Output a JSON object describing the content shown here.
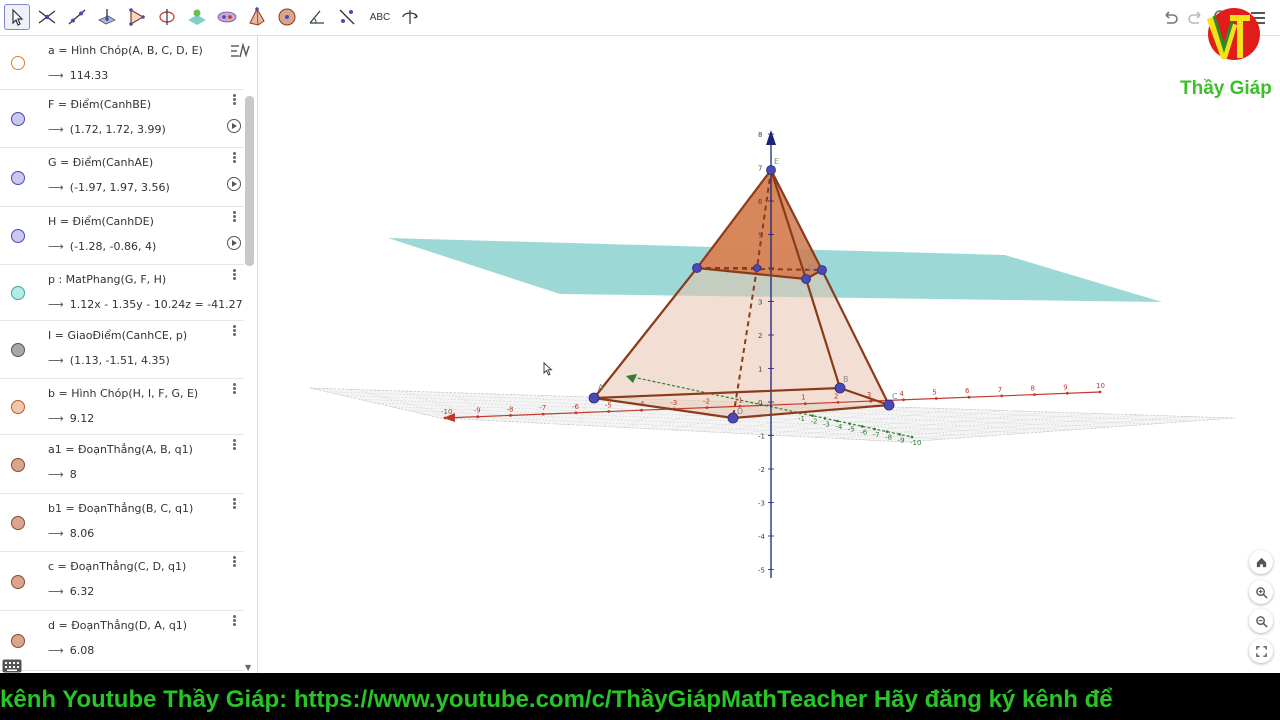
{
  "toolbar": {
    "tools": [
      {
        "name": "move-tool-icon",
        "active": true
      },
      {
        "name": "intersect-tool-icon"
      },
      {
        "name": "line-tool-icon"
      },
      {
        "name": "perpendicular-plane-tool-icon"
      },
      {
        "name": "polygon-tool-icon"
      },
      {
        "name": "circle-axis-tool-icon"
      },
      {
        "name": "plane-tool-icon"
      },
      {
        "name": "net-tool-icon"
      },
      {
        "name": "pyramid-tool-icon"
      },
      {
        "name": "sphere-tool-icon"
      },
      {
        "name": "angle-tool-icon"
      },
      {
        "name": "reflect-tool-icon"
      },
      {
        "name": "text-tool-icon",
        "text": "ABC"
      },
      {
        "name": "rotate-view-tool-icon"
      }
    ]
  },
  "algebra": {
    "rows": [
      {
        "def": "a = Hình Chóp(A, B, C, D, E)",
        "value": "114.33",
        "color": "#ffffff",
        "border": "#d9812f",
        "play": false
      },
      {
        "def": "F = Điểm(CanhBE)",
        "value": "(1.72, 1.72, 3.99)",
        "color": "#c8c8f0",
        "border": "#4a4ab0",
        "play": true
      },
      {
        "def": "G = Điểm(CanhAE)",
        "value": "(-1.97, 1.97, 3.56)",
        "color": "#c8c8f0",
        "border": "#4a4ab0",
        "play": true
      },
      {
        "def": "H = Điểm(CanhDE)",
        "value": "(-1.28, -0.86, 4)",
        "color": "#c8c8f0",
        "border": "#4a4ab0",
        "play": true
      },
      {
        "def": "p : MatPhang(G, F, H)",
        "value": "1.12x - 1.35y - 10.24z = -41.27",
        "color": "#b6ece8",
        "border": "#3aa59c",
        "play": false
      },
      {
        "def": "I = GiaoĐiểm(CanhCE, p)",
        "value": "(1.13, -1.51, 4.35)",
        "color": "#a8a8a8",
        "border": "#555555",
        "play": false
      },
      {
        "def": "b = Hình Chóp(H, I, F, G, E)",
        "value": "9.12",
        "color": "#f2c6a8",
        "border": "#b06030",
        "play": false
      },
      {
        "def": "a1 = ĐoạnThẳng(A, B, q1)",
        "value": "8",
        "color": "#d9a58c",
        "border": "#8a4a30",
        "play": false
      },
      {
        "def": "b1 = ĐoạnThẳng(B, C, q1)",
        "value": "8.06",
        "color": "#d9a58c",
        "border": "#8a4a30",
        "play": false
      },
      {
        "def": "c = ĐoạnThẳng(C, D, q1)",
        "value": "6.32",
        "color": "#d9a58c",
        "border": "#8a4a30",
        "play": false
      },
      {
        "def": "d = ĐoạnThẳng(D, A, q1)",
        "value": "6.08",
        "color": "#d9a58c",
        "border": "#8a4a30",
        "play": false
      }
    ]
  },
  "graphics": {
    "z_ticks": [
      "8",
      "7",
      "6",
      "5",
      "4",
      "3",
      "2",
      "1",
      "0",
      "-1",
      "-2",
      "-3",
      "-4",
      "-5"
    ],
    "x_ticks": [
      "-10",
      "-9",
      "-8",
      "-7",
      "-6",
      "-5",
      "-4",
      "-3",
      "-2",
      "-1",
      "1",
      "2",
      "3",
      "4",
      "5",
      "6",
      "7",
      "8",
      "9",
      "10"
    ],
    "y_ticks": [
      "-10",
      "-9",
      "-8",
      "-7",
      "-6",
      "-5",
      "-4",
      "-3",
      "-2",
      "-1"
    ],
    "point_labels": {
      "E": "E",
      "G": "G",
      "A": "A",
      "B": "B",
      "C": "C",
      "D": "D"
    },
    "colors": {
      "pyramid_edge": "#8b3a1a",
      "pyramid_fill": "#cf7a4e",
      "plane": "#4bbab4",
      "x_axis": "#c0392b",
      "y_axis": "#2e7d32",
      "z_axis": "#1a237e",
      "point": "#4a4ab0"
    }
  },
  "logo_text": "Thầy Giáp",
  "ticker_text": "kênh Youtube Thầy Giáp:  https://www.youtube.com/c/ThầyGiápMathTeacher    Hãy đăng ký kênh để"
}
